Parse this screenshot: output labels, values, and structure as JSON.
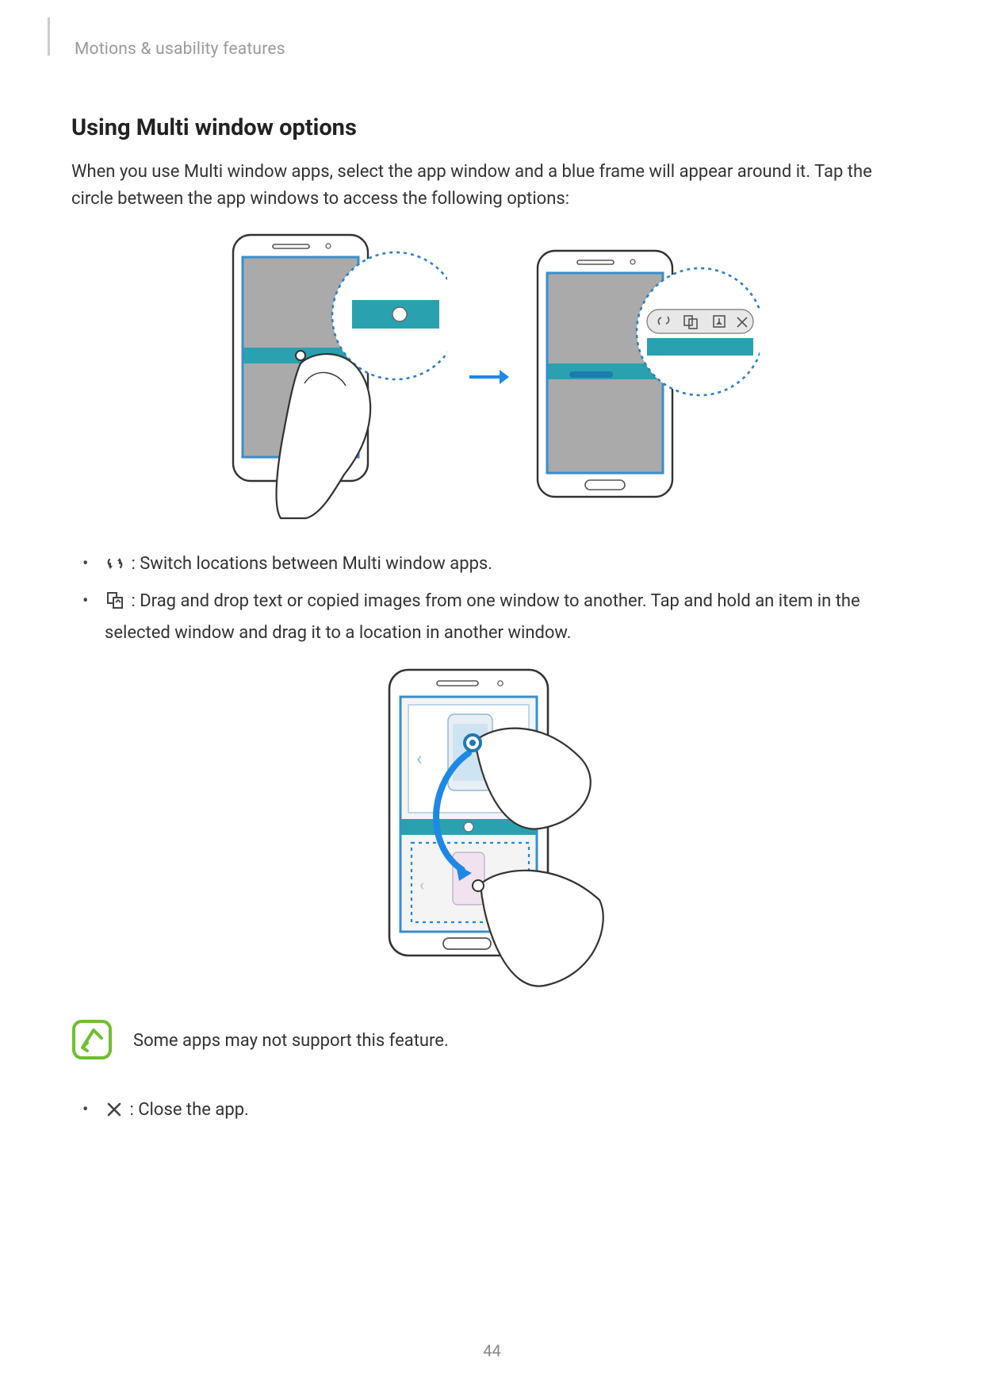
{
  "breadcrumb": "Motions & usability features",
  "heading": "Using Multi window options",
  "intro": "When you use Multi window apps, select the app window and a blue frame will appear around it. Tap the circle between the app windows to access the following options:",
  "bullets": {
    "switch": " : Switch locations between Multi window apps.",
    "drag": " : Drag and drop text or copied images from one window to another. Tap and hold an item in the selected window and drag it to a location in another window."
  },
  "note": "Some apps may not support this feature.",
  "close_bullet": " : Close the app.",
  "page_number": "44"
}
